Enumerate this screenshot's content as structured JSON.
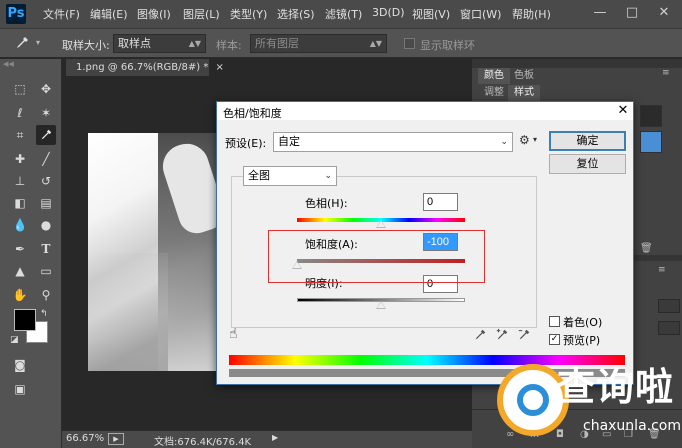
{
  "app_logo": "Ps",
  "menu": [
    "文件(F)",
    "编辑(E)",
    "图像(I)",
    "图层(L)",
    "类型(Y)",
    "选择(S)",
    "滤镜(T)",
    "3D(D)",
    "视图(V)",
    "窗口(W)",
    "帮助(H)"
  ],
  "window_controls": [
    "—",
    "□",
    "✕"
  ],
  "options_bar": {
    "sample_size_label": "取样大小:",
    "sample_size_value": "取样点",
    "sample_label": "样本:",
    "sample_value": "所有图层",
    "show_ring_label": "显示取样环"
  },
  "document": {
    "tab_title": "1.png @ 66.7%(RGB/8#) *",
    "tab_close": "×",
    "zoom": "66.67%",
    "doc_info": "文档:676.4K/676.4K"
  },
  "panels": {
    "tabs_top": [
      "颜色",
      "色板"
    ],
    "tabs_mid": [
      "调整",
      "样式"
    ]
  },
  "dialog": {
    "title": "色相/饱和度",
    "close": "✕",
    "preset_label": "预设(E):",
    "preset_value": "自定",
    "channel_value": "全图",
    "hue_label": "色相(H):",
    "hue_value": "0",
    "saturation_label": "饱和度(A):",
    "saturation_value": "-100",
    "lightness_label": "明度(I):",
    "lightness_value": "0",
    "ok_label": "确定",
    "reset_label": "复位",
    "colorize_label": "着色(O)",
    "colorize_checked": false,
    "preview_label": "预览(P)",
    "preview_checked": true,
    "hue_slider_position": 0.5,
    "saturation_slider_position": 0.0,
    "lightness_slider_position": 0.5
  },
  "watermark": {
    "cn_text": "查询啦",
    "url_text": "chaxunla.com"
  },
  "colors": {
    "highlight_box": "#e03030",
    "default_button_border": "#3c7fb1",
    "app_chrome": "#535353"
  }
}
